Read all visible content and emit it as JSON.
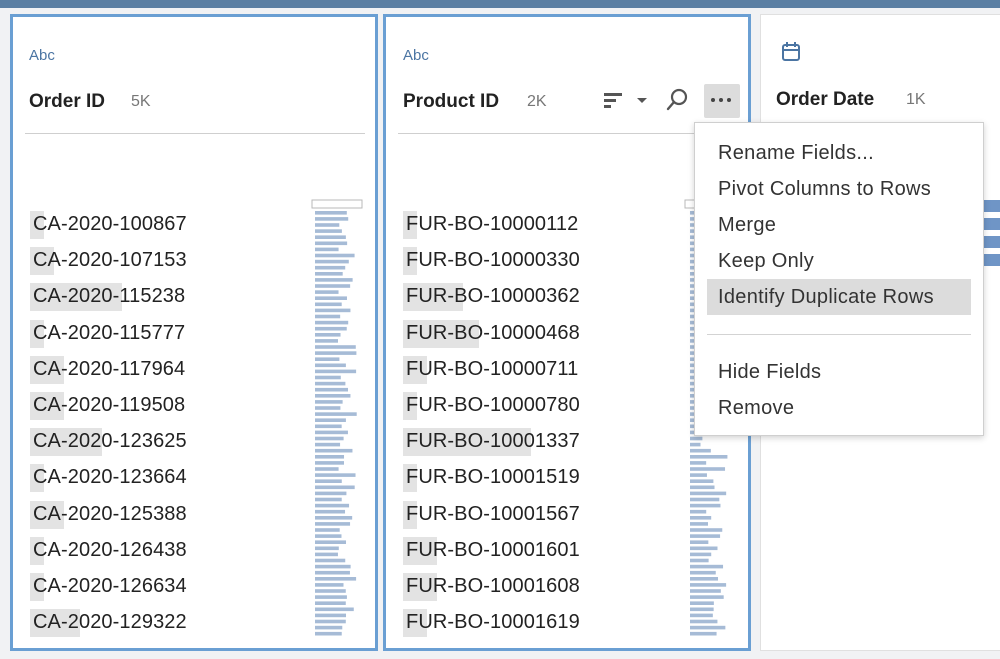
{
  "colors": {
    "accent": "#6a9fd3",
    "bar": "#a6bbd6",
    "highlight": "#e3e3e3",
    "type_label": "#4b75a3"
  },
  "columns": [
    {
      "type_label": "Abc",
      "name": "Order ID",
      "count": "5K",
      "values": [
        "CA-2020-100867",
        "CA-2020-107153",
        "CA-2020-115238",
        "CA-2020-115777",
        "CA-2020-117964",
        "CA-2020-119508",
        "CA-2020-123625",
        "CA-2020-123664",
        "CA-2020-125388",
        "CA-2020-126438",
        "CA-2020-126634",
        "CA-2020-129322"
      ]
    },
    {
      "type_label": "Abc",
      "name": "Product ID",
      "count": "2K",
      "values": [
        "FUR-BO-10000112",
        "FUR-BO-10000330",
        "FUR-BO-10000362",
        "FUR-BO-10000468",
        "FUR-BO-10000711",
        "FUR-BO-10000780",
        "FUR-BO-10001337",
        "FUR-BO-10001519",
        "FUR-BO-10001567",
        "FUR-BO-10001601",
        "FUR-BO-10001608",
        "FUR-BO-10001619"
      ]
    },
    {
      "type_icon": "calendar-icon",
      "name": "Order Date",
      "count": "1K"
    }
  ],
  "toolbar_icons": [
    "sort-icon",
    "chevron-down-icon",
    "search-icon",
    "more-options-icon"
  ],
  "context_menu": {
    "items": [
      "Rename Fields...",
      "Pivot Columns to Rows",
      "Merge",
      "Keep Only",
      "Identify Duplicate Rows"
    ],
    "items_after_divider": [
      "Hide Fields",
      "Remove"
    ],
    "active_item": "Identify Duplicate Rows"
  }
}
